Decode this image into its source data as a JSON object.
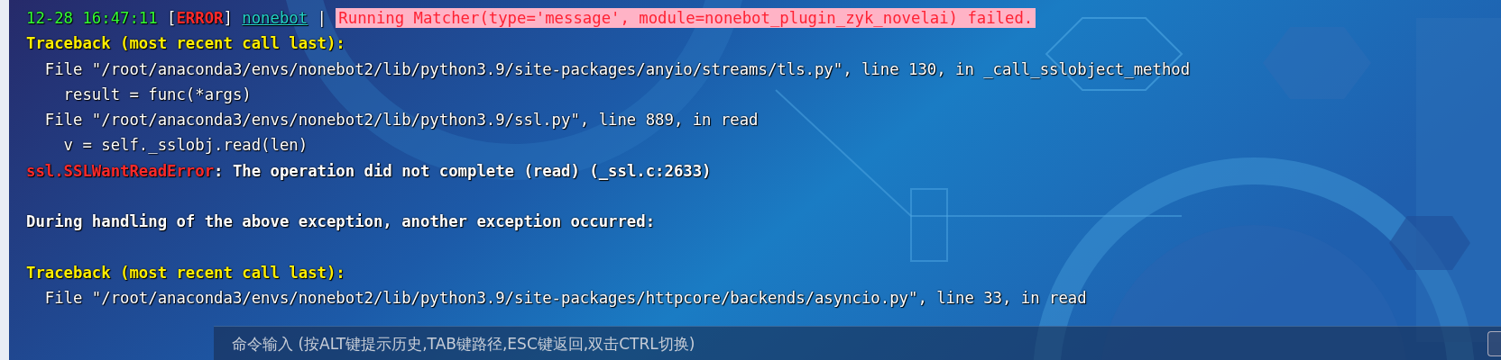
{
  "lines": [
    {
      "kind": "log",
      "segments": [
        {
          "kind": "timestamp",
          "text": "12-28 16:47:11",
          "spaced": false
        },
        {
          "kind": "bracket",
          "text": "[",
          "spaced": true
        },
        {
          "kind": "level",
          "text": "ERROR",
          "spaced": false
        },
        {
          "kind": "bracket",
          "text": "]",
          "spaced": false
        },
        {
          "kind": "logger",
          "text": "nonebot",
          "spaced": true
        },
        {
          "kind": "bracket",
          "text": "|",
          "spaced": true
        },
        {
          "kind": "highlight",
          "text": "Running Matcher(type='message', module=nonebot_plugin_zyk_novelai) failed.",
          "spaced": true
        }
      ]
    },
    {
      "kind": "header",
      "segments": [
        {
          "kind": "plain",
          "text": "Traceback (most recent call last):",
          "spaced": false
        }
      ]
    },
    {
      "kind": "frame",
      "segments": [
        {
          "kind": "plain",
          "text": "File \"/root/anaconda3/envs/nonebot2/lib/python3.9/site-packages/anyio/streams/tls.py\", line 130, in _call_sslobject_method",
          "spaced": false
        }
      ]
    },
    {
      "kind": "code",
      "segments": [
        {
          "kind": "plain",
          "text": "result = func(*args)",
          "spaced": false
        }
      ]
    },
    {
      "kind": "frame",
      "segments": [
        {
          "kind": "plain",
          "text": "File \"/root/anaconda3/envs/nonebot2/lib/python3.9/ssl.py\", line 889, in read",
          "spaced": false
        }
      ]
    },
    {
      "kind": "code",
      "segments": [
        {
          "kind": "plain",
          "text": "v = self._sslobj.read(len)",
          "spaced": false
        }
      ]
    },
    {
      "kind": "notice",
      "segments": [
        {
          "kind": "error_name",
          "text": "ssl.SSLWantReadError",
          "spaced": false
        },
        {
          "kind": "plain",
          "text": ": The operation did not complete (read) (_ssl.c:2633)",
          "spaced": false
        }
      ]
    },
    {
      "kind": "blank"
    },
    {
      "kind": "notice",
      "segments": [
        {
          "kind": "plain",
          "text": "During handling of the above exception, another exception occurred:",
          "spaced": false
        }
      ]
    },
    {
      "kind": "blank"
    },
    {
      "kind": "header",
      "segments": [
        {
          "kind": "plain",
          "text": "Traceback (most recent call last):",
          "spaced": false
        }
      ]
    },
    {
      "kind": "frame",
      "segments": [
        {
          "kind": "plain",
          "text": "File \"/root/anaconda3/envs/nonebot2/lib/python3.9/site-packages/httpcore/backends/asyncio.py\", line 33, in read",
          "spaced": false
        }
      ]
    }
  ],
  "command_input": {
    "placeholder": "命令输入 (按ALT键提示历史,TAB键路径,ESC键返回,双击CTRL切换)"
  }
}
